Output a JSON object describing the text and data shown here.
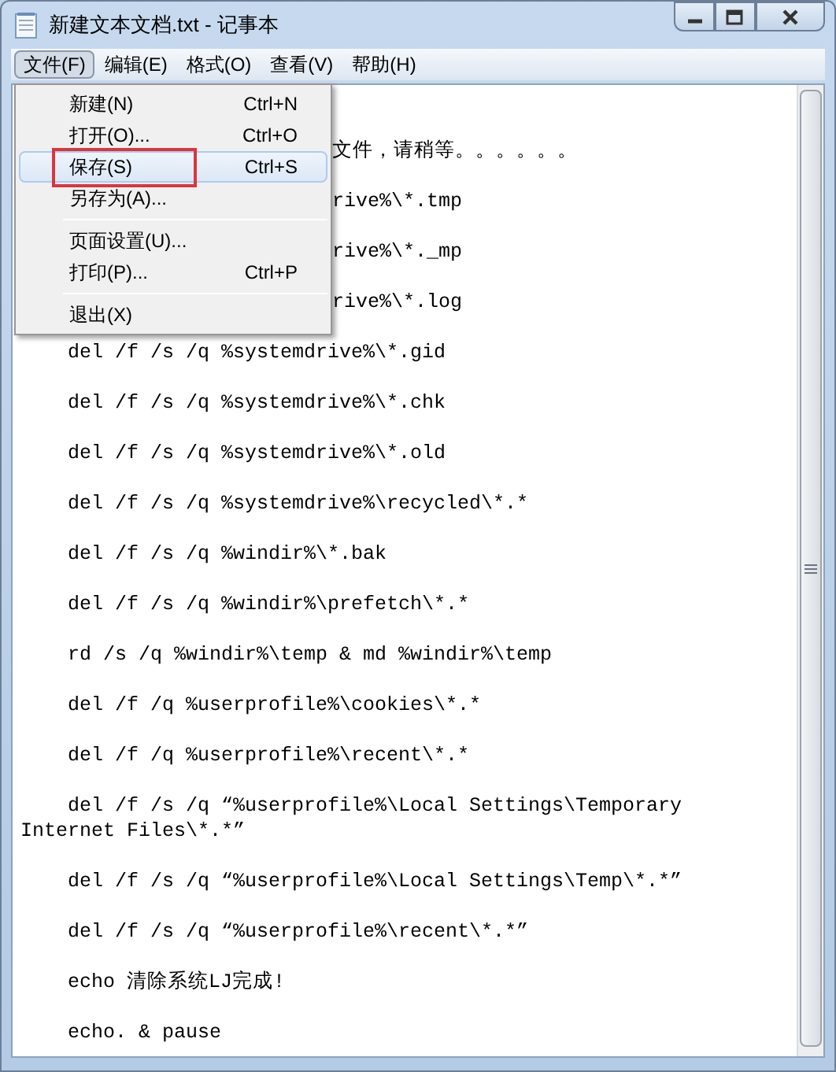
{
  "window": {
    "title": "新建文本文档.txt - 记事本",
    "controls": [
      {
        "kind": "minimize"
      },
      {
        "kind": "maximize"
      },
      {
        "kind": "close"
      }
    ]
  },
  "menu_bar": [
    {
      "label": "文件(F)",
      "selected": true
    },
    {
      "label": "编辑(E)",
      "selected": false
    },
    {
      "label": "格式(O)",
      "selected": false
    },
    {
      "label": "查看(V)",
      "selected": false
    },
    {
      "label": "帮助(H)",
      "selected": false
    }
  ],
  "file_menu": [
    {
      "kind": "item",
      "label": "新建(N)",
      "shortcut": "Ctrl+N",
      "selected": false,
      "marked": false
    },
    {
      "kind": "item",
      "label": "打开(O)...",
      "shortcut": "Ctrl+O",
      "selected": false,
      "marked": false
    },
    {
      "kind": "item",
      "label": "保存(S)",
      "shortcut": "Ctrl+S",
      "selected": true,
      "marked": true
    },
    {
      "kind": "item",
      "label": "另存为(A)...",
      "selected": false,
      "marked": false
    },
    {
      "kind": "separator"
    },
    {
      "kind": "item",
      "label": "页面设置(U)...",
      "selected": false,
      "marked": false
    },
    {
      "kind": "item",
      "label": "打印(P)...",
      "shortcut": "Ctrl+P",
      "selected": false,
      "marked": false
    },
    {
      "kind": "separator"
    },
    {
      "kind": "item",
      "label": "退出(X)",
      "selected": false,
      "marked": false
    }
  ],
  "editor_lines": [
    {
      "kind": "partial",
      "text": "文件，请稍等。。。。。。"
    },
    {
      "kind": "partial",
      "text": "rive%\\*.tmp"
    },
    {
      "kind": "partial",
      "text": "rive%\\*._mp"
    },
    {
      "kind": "partial",
      "text": "rive%\\*.log"
    },
    {
      "kind": "full",
      "text": "del /f /s /q %systemdrive%\\*.gid"
    },
    {
      "kind": "full",
      "text": "del /f /s /q %systemdrive%\\*.chk"
    },
    {
      "kind": "full",
      "text": "del /f /s /q %systemdrive%\\*.old"
    },
    {
      "kind": "full",
      "text": "del /f /s /q %systemdrive%\\recycled\\*.*"
    },
    {
      "kind": "full",
      "text": "del /f /s /q %windir%\\*.bak"
    },
    {
      "kind": "full",
      "text": "del /f /s /q %windir%\\prefetch\\*.*"
    },
    {
      "kind": "full",
      "text": "rd /s /q %windir%\\temp & md %windir%\\temp"
    },
    {
      "kind": "full",
      "text": "del /f /q %userprofile%\\cookies\\*.*"
    },
    {
      "kind": "full",
      "text": "del /f /q %userprofile%\\recent\\*.*"
    },
    {
      "kind": "full",
      "text": "del /f /s /q “%userprofile%\\Local Settings\\Temporary Internet Files\\*.*”"
    },
    {
      "kind": "full",
      "text": "del /f /s /q “%userprofile%\\Local Settings\\Temp\\*.*”"
    },
    {
      "kind": "full",
      "text": "del /f /s /q “%userprofile%\\recent\\*.*”"
    },
    {
      "kind": "full",
      "text": "echo 清除系统LJ完成!"
    },
    {
      "kind": "full",
      "text": "echo. & pause"
    }
  ]
}
